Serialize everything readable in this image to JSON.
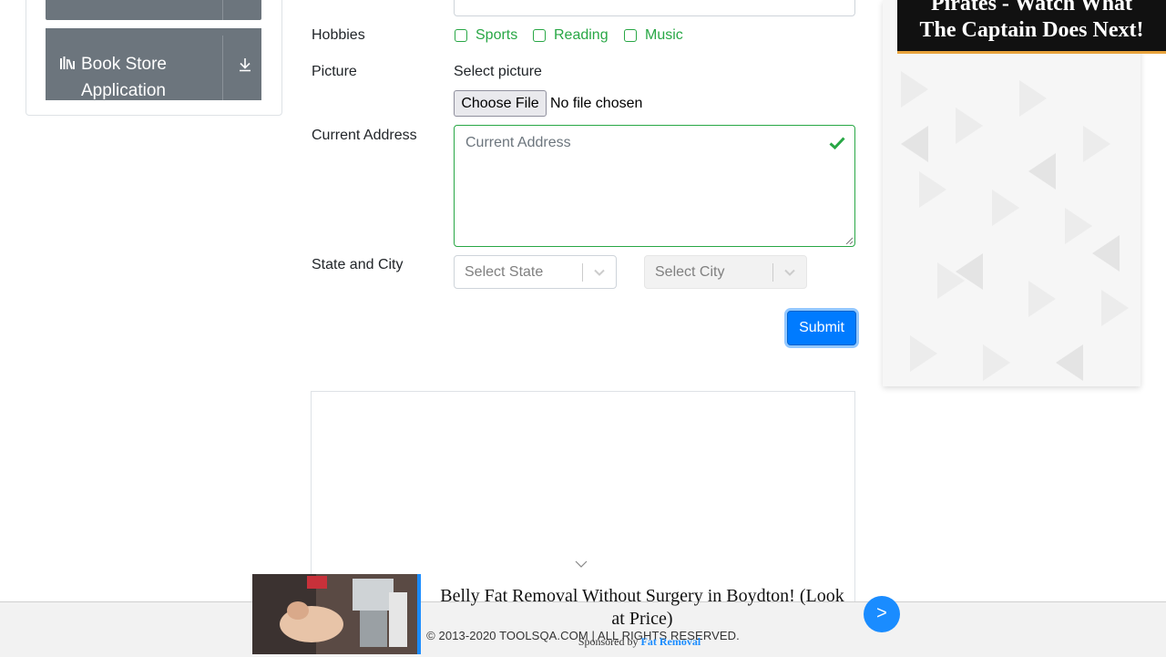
{
  "sidebar": {
    "item": {
      "label": "Book Store Application",
      "icon": "books-icon",
      "action_icon": "download-icon"
    }
  },
  "form": {
    "hobbies": {
      "label": "Hobbies",
      "options": [
        "Sports",
        "Reading",
        "Music"
      ]
    },
    "picture": {
      "label": "Picture",
      "caption": "Select picture",
      "button": "Choose File",
      "status": "No file chosen"
    },
    "current_address": {
      "label": "Current Address",
      "placeholder": "Current Address"
    },
    "state_city": {
      "label": "State and City",
      "state_placeholder": "Select State",
      "city_placeholder": "Select City"
    },
    "submit": "Submit"
  },
  "ads": {
    "right_banner": {
      "line1": "Pirates - Watch What",
      "line2": "The Captain Does Next!"
    },
    "bottom": {
      "headline": "Belly Fat Removal Without Surgery in Boydton! (Look at Price)",
      "sponsored_prefix": "Sponsored by",
      "sponsor": "Fat Removal",
      "button": ">"
    }
  },
  "footer": {
    "copyright": "© 2013-2020 TOOLSQA.COM | ALL RIGHTS RESERVED."
  },
  "colors": {
    "accent": "#007bff",
    "valid": "#28a745",
    "sidebar_item": "#6c757d",
    "ad_blue": "#1a8cff",
    "banner_border": "#e8a33c"
  }
}
